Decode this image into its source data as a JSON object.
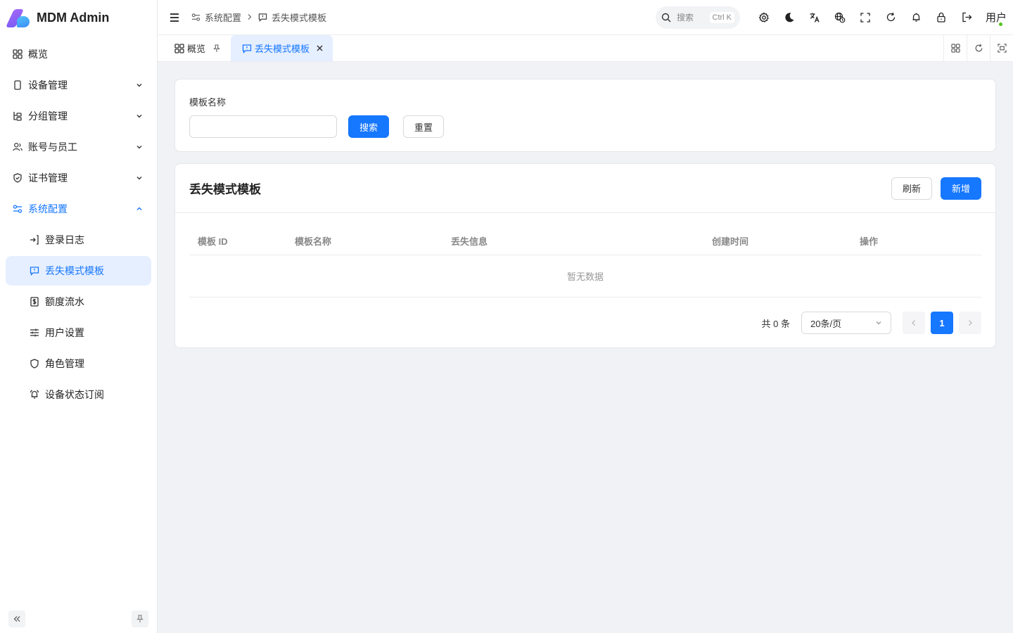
{
  "app": {
    "title": "MDM Admin"
  },
  "sidebar": {
    "items": [
      {
        "label": "概览",
        "icon": "dashboard-icon"
      },
      {
        "label": "设备管理",
        "icon": "device-icon"
      },
      {
        "label": "分组管理",
        "icon": "group-icon"
      },
      {
        "label": "账号与员工",
        "icon": "users-icon"
      },
      {
        "label": "证书管理",
        "icon": "shield-check-icon"
      },
      {
        "label": "系统配置",
        "icon": "settings-sliders-icon"
      }
    ],
    "sub_items": [
      {
        "label": "登录日志",
        "icon": "login-icon"
      },
      {
        "label": "丢失模式模板",
        "icon": "message-alert-icon"
      },
      {
        "label": "额度流水",
        "icon": "dollar-receipt-icon"
      },
      {
        "label": "用户设置",
        "icon": "sliders-icon"
      },
      {
        "label": "角色管理",
        "icon": "shield-icon"
      },
      {
        "label": "设备状态订阅",
        "icon": "bell-ring-icon"
      }
    ]
  },
  "header": {
    "breadcrumb": [
      "系统配置",
      "丢失模式模板"
    ],
    "search_placeholder": "搜索",
    "search_shortcut": "Ctrl K",
    "user_label": "用户"
  },
  "tabs": [
    {
      "label": "概览"
    },
    {
      "label": "丢失模式模板"
    }
  ],
  "filter": {
    "name_label": "模板名称",
    "name_value": "",
    "search_button": "搜索",
    "reset_button": "重置"
  },
  "table": {
    "title": "丢失模式模板",
    "refresh_button": "刷新",
    "add_button": "新增",
    "columns": [
      "模板 ID",
      "模板名称",
      "丢失信息",
      "创建时间",
      "操作"
    ],
    "empty_text": "暂无数据"
  },
  "pagination": {
    "total_text": "共 0 条",
    "page_size": "20条/页",
    "current_page": "1"
  },
  "colors": {
    "primary": "#1677ff",
    "active_bg": "#e6efff",
    "page_bg": "#f0f2f5"
  }
}
